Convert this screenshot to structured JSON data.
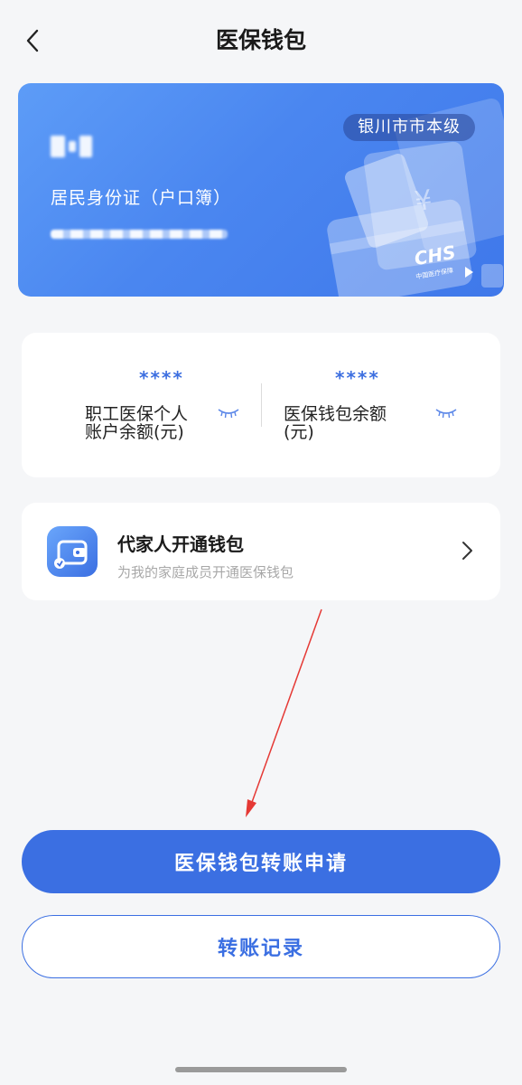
{
  "header": {
    "title": "医保钱包"
  },
  "card": {
    "region": "银川市市本级",
    "id_type": "居民身份证（户口簿）",
    "brand_logo": "CHS",
    "brand_logo_sub": "中国医疗保障"
  },
  "balances": [
    {
      "value": "****",
      "label": "职工医保个人账户余额(元)",
      "icon": "eye-closed-icon"
    },
    {
      "value": "****",
      "label": "医保钱包余额(元)",
      "icon": "eye-closed-icon"
    }
  ],
  "family": {
    "title": "代家人开通钱包",
    "subtitle": "为我的家庭成员开通医保钱包",
    "icon": "wallet-icon"
  },
  "actions": {
    "transfer_apply": "医保钱包转账申请",
    "transfer_records": "转账记录"
  },
  "colors": {
    "accent": "#3b6fe2",
    "card_gradient_start": "#5d9cf7",
    "card_gradient_end": "#3f78ea",
    "masked_value": "#3d6fe0",
    "annotation_arrow": "#e53935"
  }
}
